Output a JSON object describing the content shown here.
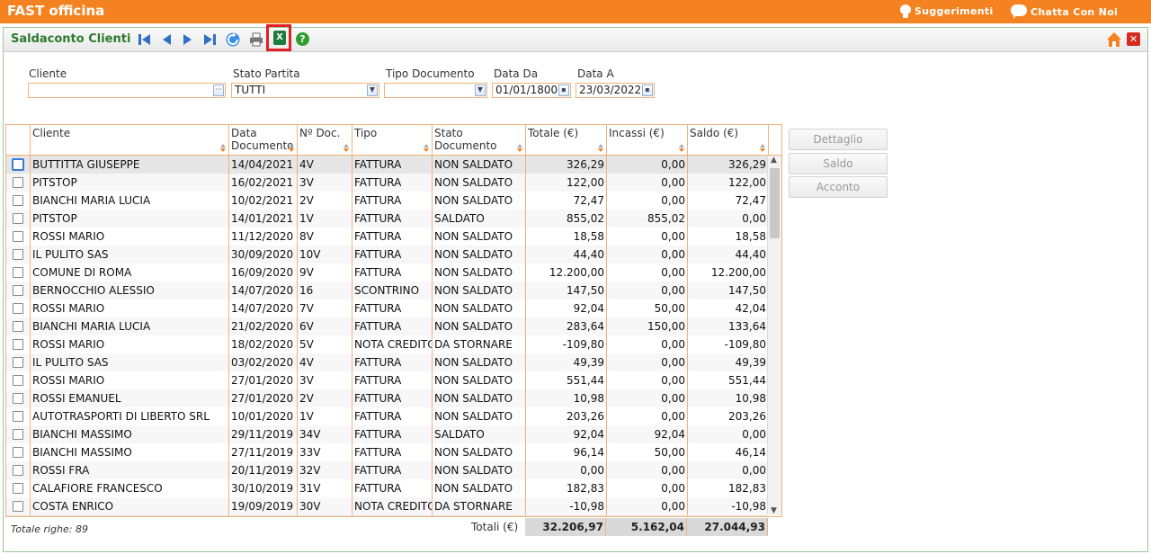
{
  "app": {
    "title": "FAST officina",
    "suggestions_label": "Suggerimenti",
    "chat_label": "Chatta Con Noi"
  },
  "window": {
    "title": "Saldaconto Clienti"
  },
  "toolbar": {
    "icons": [
      "first-record-icon",
      "prev-record-icon",
      "next-record-icon",
      "last-record-icon",
      "refresh-icon",
      "print-icon",
      "excel-export-icon",
      "help-icon"
    ],
    "excel_glyph": "X",
    "help_glyph": "?",
    "close_glyph": "✕"
  },
  "filters": {
    "cliente": {
      "label": "Cliente",
      "value": ""
    },
    "stato_partita": {
      "label": "Stato Partita",
      "value": "TUTTI"
    },
    "tipo_documento": {
      "label": "Tipo Documento",
      "value": ""
    },
    "data_da": {
      "label": "Data Da",
      "value": "01/01/1800"
    },
    "data_a": {
      "label": "Data A",
      "value": "23/03/2022"
    }
  },
  "table": {
    "columns": [
      "Cliente",
      "Data Documento",
      "Nº Doc.",
      "Tipo",
      "Stato Documento",
      "Totale (€)",
      "Incassi (€)",
      "Saldo (€)"
    ],
    "col_data_line1": "Data",
    "col_data_line2": "Documento",
    "rows": [
      [
        "BUTTITTA GIUSEPPE",
        "14/04/2021",
        "4V",
        "FATTURA",
        "NON SALDATO",
        "326,29",
        "0,00",
        "326,29"
      ],
      [
        "PITSTOP",
        "16/02/2021",
        "3V",
        "FATTURA",
        "NON SALDATO",
        "122,00",
        "0,00",
        "122,00"
      ],
      [
        "BIANCHI MARIA LUCIA",
        "10/02/2021",
        "2V",
        "FATTURA",
        "NON SALDATO",
        "72,47",
        "0,00",
        "72,47"
      ],
      [
        "PITSTOP",
        "14/01/2021",
        "1V",
        "FATTURA",
        "SALDATO",
        "855,02",
        "855,02",
        "0,00"
      ],
      [
        "ROSSI MARIO",
        "11/12/2020",
        "8V",
        "FATTURA",
        "NON SALDATO",
        "18,58",
        "0,00",
        "18,58"
      ],
      [
        "IL PULITO SAS",
        "30/09/2020",
        "10V",
        "FATTURA",
        "NON SALDATO",
        "44,40",
        "0,00",
        "44,40"
      ],
      [
        "COMUNE DI ROMA",
        "16/09/2020",
        "9V",
        "FATTURA",
        "NON SALDATO",
        "12.200,00",
        "0,00",
        "12.200,00"
      ],
      [
        "BERNOCCHIO ALESSIO",
        "14/07/2020",
        "16",
        "SCONTRINO",
        "NON SALDATO",
        "147,50",
        "0,00",
        "147,50"
      ],
      [
        "ROSSI MARIO",
        "14/07/2020",
        "7V",
        "FATTURA",
        "NON SALDATO",
        "92,04",
        "50,00",
        "42,04"
      ],
      [
        "BIANCHI MARIA LUCIA",
        "21/02/2020",
        "6V",
        "FATTURA",
        "NON SALDATO",
        "283,64",
        "150,00",
        "133,64"
      ],
      [
        "ROSSI MARIO",
        "18/02/2020",
        "5V",
        "NOTA CREDITO",
        "DA STORNARE",
        "-109,80",
        "0,00",
        "-109,80"
      ],
      [
        "IL PULITO SAS",
        "03/02/2020",
        "4V",
        "FATTURA",
        "NON SALDATO",
        "49,39",
        "0,00",
        "49,39"
      ],
      [
        "ROSSI MARIO",
        "27/01/2020",
        "3V",
        "FATTURA",
        "NON SALDATO",
        "551,44",
        "0,00",
        "551,44"
      ],
      [
        "ROSSI EMANUEL",
        "27/01/2020",
        "2V",
        "FATTURA",
        "NON SALDATO",
        "10,98",
        "0,00",
        "10,98"
      ],
      [
        "AUTOTRASPORTI DI LIBERTO SRL",
        "10/01/2020",
        "1V",
        "FATTURA",
        "NON SALDATO",
        "203,26",
        "0,00",
        "203,26"
      ],
      [
        "BIANCHI MASSIMO",
        "29/11/2019",
        "34V",
        "FATTURA",
        "SALDATO",
        "92,04",
        "92,04",
        "0,00"
      ],
      [
        "BIANCHI MASSIMO",
        "27/11/2019",
        "33V",
        "FATTURA",
        "NON SALDATO",
        "96,14",
        "50,00",
        "46,14"
      ],
      [
        "ROSSI FRA",
        "20/11/2019",
        "32V",
        "FATTURA",
        "NON SALDATO",
        "0,00",
        "0,00",
        "0,00"
      ],
      [
        "CALAFIORE FRANCESCO",
        "30/10/2019",
        "31V",
        "FATTURA",
        "NON SALDATO",
        "182,83",
        "0,00",
        "182,83"
      ],
      [
        "COSTA ENRICO",
        "19/09/2019",
        "30V",
        "NOTA CREDITO",
        "DA STORNARE",
        "-10,98",
        "0,00",
        "-10,98"
      ]
    ]
  },
  "actions": {
    "dettaglio": "Dettaglio",
    "saldo": "Saldo",
    "acconto": "Acconto"
  },
  "footer": {
    "total_rows": "Totale righe: 89",
    "totals_label": "Totali (€)",
    "totale": "32.206,97",
    "incassi": "5.162,04",
    "saldo": "27.044,93"
  },
  "colors": {
    "brand_orange": "#f58220",
    "title_green": "#2d7a2d",
    "grid_border": "#f0b27a",
    "highlight_red": "#e01f26"
  }
}
